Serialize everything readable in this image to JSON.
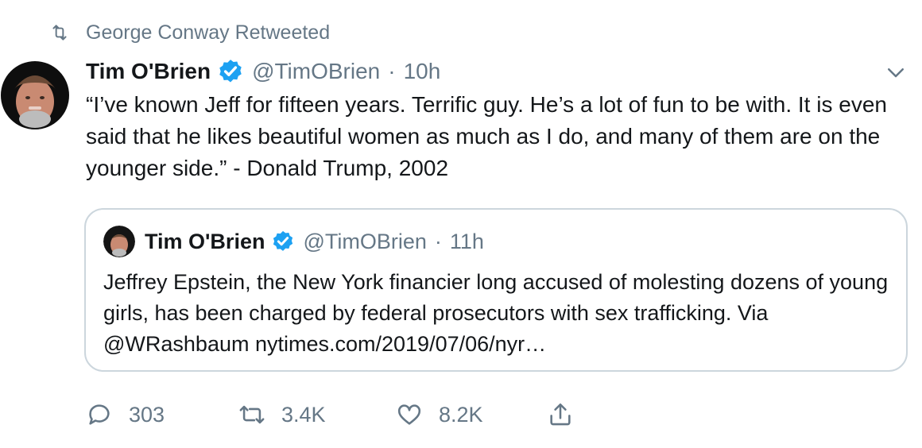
{
  "retweeted_by": "George Conway Retweeted",
  "tweet": {
    "name": "Tim O'Brien",
    "handle": "@TimOBrien",
    "separator": "·",
    "time": "10h",
    "text": "“I’ve known Jeff for fifteen years. Terrific guy. He’s a lot of fun to be with. It is even said that he likes beautiful women as much as I do, and many of them are on the younger side.” - Donald Trump, 2002"
  },
  "quoted_tweet": {
    "name": "Tim O'Brien",
    "handle": "@TimOBrien",
    "separator": "·",
    "time": "11h",
    "text": "Jeffrey Epstein, the New York financier long accused of molesting dozens of young girls, has been charged by federal prosecutors with sex trafficking. Via @WRashbaum  nytimes.com/2019/07/06/nyr…"
  },
  "actions": {
    "replies": "303",
    "retweets": "3.4K",
    "likes": "8.2K"
  },
  "icons": {
    "retweet": "retweet-icon",
    "verified": "verified-badge-icon",
    "caret": "chevron-down-icon",
    "reply": "reply-icon",
    "like": "heart-icon",
    "share": "share-icon"
  },
  "colors": {
    "verified": "#1da1f2",
    "secondary_text": "#657786",
    "border": "#ccd6dd"
  }
}
